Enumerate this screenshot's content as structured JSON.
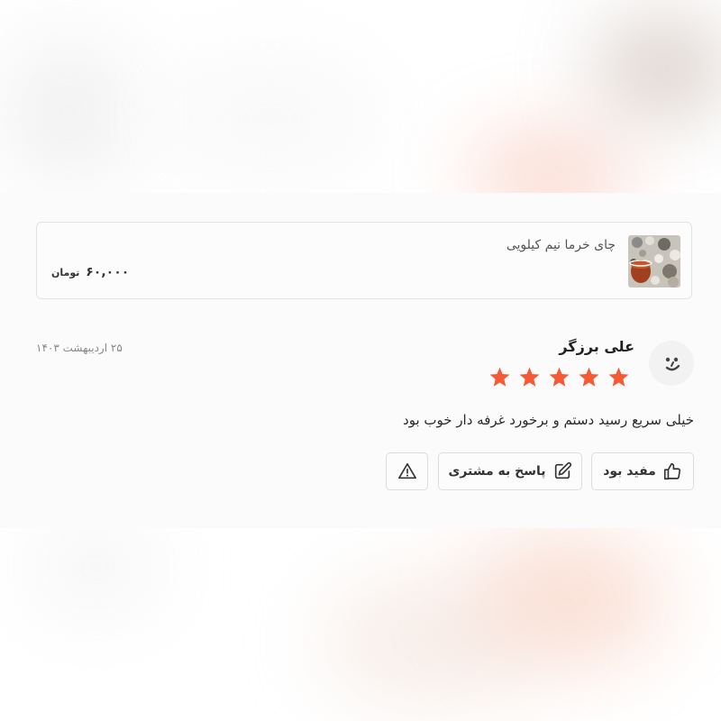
{
  "product": {
    "name": "چای خرما نیم کیلویی",
    "price": "۶۰,۰۰۰",
    "currency": "تومان",
    "thumbnail_icon": "tea-product-photo"
  },
  "review": {
    "reviewer_name": "علی برزگر",
    "date": "۲۵ اردیبهشت ۱۴۰۳",
    "rating": 5,
    "rating_max": 5,
    "text": "خیلی سریع رسید دستم و برخورد غرفه دار خوب بود",
    "avatar_icon": "smiley-face-icon"
  },
  "actions": {
    "helpful_label": "مفید بود",
    "reply_label": "پاسخ به مشتری",
    "helpful_icon": "thumbs-up-icon",
    "reply_icon": "edit-pencil-icon",
    "report_icon": "warning-icon"
  },
  "colors": {
    "star": "#f55a35",
    "text": "#2b2b2b",
    "muted": "#888888",
    "border": "#dddddd"
  }
}
